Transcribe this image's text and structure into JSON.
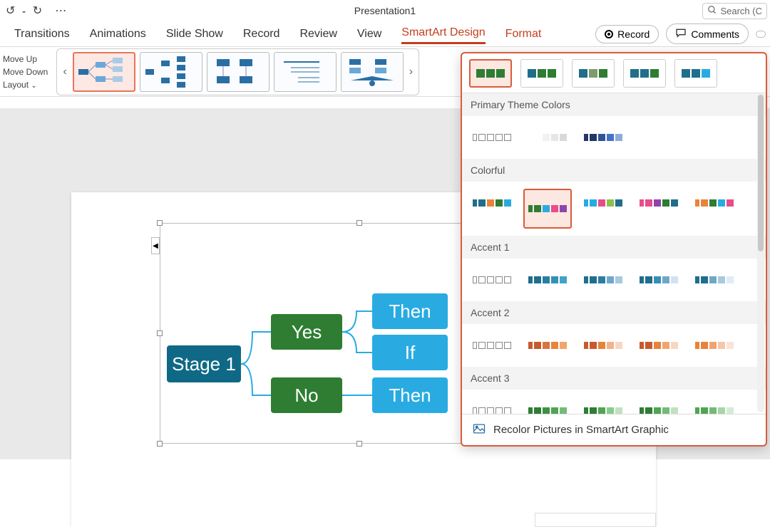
{
  "titlebar": {
    "title": "Presentation1",
    "search_placeholder": "Search (C"
  },
  "tabs": {
    "transitions": "Transitions",
    "animations": "Animations",
    "slideshow": "Slide Show",
    "record": "Record",
    "review": "Review",
    "view": "View",
    "smartart_design": "SmartArt Design",
    "format": "Format"
  },
  "ribbon_right": {
    "record": "Record",
    "comments": "Comments"
  },
  "move": {
    "up": "Move Up",
    "down": "Move Down",
    "layout": "Layout"
  },
  "smartart": {
    "stage": "Stage 1",
    "yes": "Yes",
    "no": "No",
    "then": "Then",
    "if": "If"
  },
  "color_panel": {
    "primary": "Primary Theme Colors",
    "colorful": "Colorful",
    "accent1": "Accent 1",
    "accent2": "Accent 2",
    "accent3": "Accent 3",
    "footer": "Recolor Pictures in SmartArt Graphic"
  },
  "palettes": {
    "primary": [
      [
        "#ffffff",
        "#ffffff",
        "#ffffff",
        "#ffffff"
      ],
      [
        "#ffffff",
        "#f2f2f2",
        "#e6e6e6",
        "#d9d9d9"
      ],
      [
        "#1f3864",
        "#2f5496",
        "#4472c4",
        "#8faadc"
      ]
    ],
    "colorful": [
      [
        "#1f6e8c",
        "#e8833a",
        "#2e7d32",
        "#29abe2"
      ],
      [
        "#2e7d32",
        "#29abe2",
        "#e74c8b",
        "#8e44ad"
      ],
      [
        "#29abe2",
        "#e74c8b",
        "#8bc34a",
        "#1f6e8c"
      ],
      [
        "#e74c8b",
        "#8e44ad",
        "#2e7d32",
        "#1f6e8c"
      ],
      [
        "#e8833a",
        "#2e7d32",
        "#29abe2",
        "#e74c8b"
      ]
    ],
    "accent1": [
      [
        "#ffffff",
        "#e6eef5",
        "#cddceb",
        "#b3cae0"
      ],
      [
        "#1f6e8c",
        "#2a7ea0",
        "#3590b5",
        "#40a2ca"
      ],
      [
        "#1f6e8c",
        "#2a7ea0",
        "#6fa8c7",
        "#a8c9de"
      ],
      [
        "#1f6e8c",
        "#3590b5",
        "#6fa8c7",
        "#d1e2ee"
      ],
      [
        "#1f6e8c",
        "#6fa8c7",
        "#a8c9de",
        "#e0ecf4"
      ]
    ],
    "accent2": [
      [
        "#ffffff",
        "#fbe9e1",
        "#f6d2c3",
        "#f2bca5"
      ],
      [
        "#c65a2e",
        "#d97442",
        "#e8833a",
        "#f2a46f"
      ],
      [
        "#c65a2e",
        "#e8833a",
        "#f2b28e",
        "#f8d6c5"
      ],
      [
        "#c65a2e",
        "#e8833a",
        "#f2a46f",
        "#f8d6c5"
      ],
      [
        "#e8833a",
        "#f2a46f",
        "#f6c6ab",
        "#fbe3d6"
      ]
    ],
    "accent3": [
      [
        "#ffffff",
        "#e6f2e7",
        "#cde5cf",
        "#b4d8b7"
      ],
      [
        "#2e7d32",
        "#3e9142",
        "#4ea552",
        "#72bb76"
      ],
      [
        "#2e7d32",
        "#4ea552",
        "#8acb8d",
        "#c0e2c2"
      ],
      [
        "#2e7d32",
        "#4ea552",
        "#72bb76",
        "#c0e2c2"
      ],
      [
        "#4ea552",
        "#72bb76",
        "#a5d6a7",
        "#d4ecd5"
      ]
    ],
    "style_row": [
      [
        "#2e7d32",
        "#2e7d32",
        "#2e7d32"
      ],
      [
        "#1f6e8c",
        "#2e7d32",
        "#2e7d32"
      ],
      [
        "#1f6e8c",
        "#7e9c6f",
        "#2e7d32"
      ],
      [
        "#1f6e8c",
        "#1f6e8c",
        "#2e7d32"
      ],
      [
        "#1f6e8c",
        "#1f6e8c",
        "#29abe2"
      ]
    ]
  }
}
